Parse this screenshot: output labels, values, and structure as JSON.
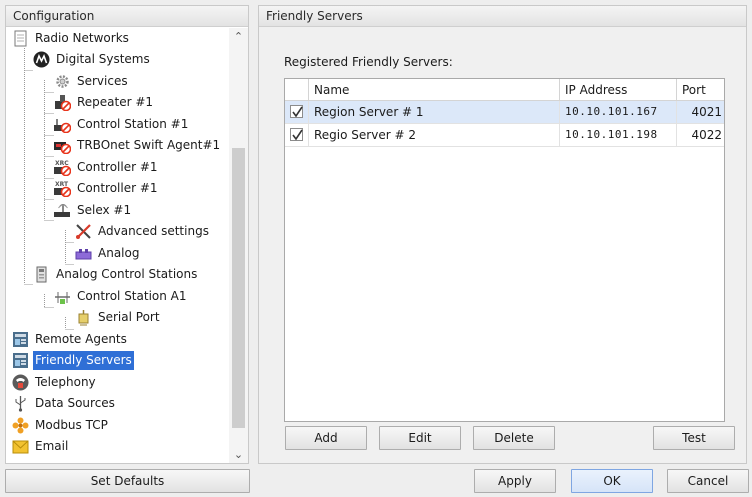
{
  "left": {
    "header": "Configuration",
    "tree": [
      {
        "label": "Radio Networks",
        "icon": "document-icon"
      },
      {
        "label": "Digital Systems",
        "icon": "motorola-logo-icon"
      },
      {
        "label": "Services",
        "icon": "gear-icon"
      },
      {
        "label": "Repeater #1",
        "icon": "repeater-disabled-icon"
      },
      {
        "label": "Control Station #1",
        "icon": "control-station-disabled-icon"
      },
      {
        "label": "TRBOnet Swift Agent#1",
        "icon": "swift-agent-disabled-icon"
      },
      {
        "label": "Controller #1",
        "icon": "xrc-controller-disabled-icon"
      },
      {
        "label": "Controller #1",
        "icon": "xrt-controller-disabled-icon"
      },
      {
        "label": "Selex #1",
        "icon": "selex-icon"
      },
      {
        "label": "Advanced settings",
        "icon": "wrench-screwdriver-icon"
      },
      {
        "label": "Analog",
        "icon": "analog-plug-icon"
      },
      {
        "label": "Analog Control Stations",
        "icon": "analog-station-icon"
      },
      {
        "label": "Control Station A1",
        "icon": "network-node-icon"
      },
      {
        "label": "Serial Port",
        "icon": "serial-port-icon"
      },
      {
        "label": "Remote Agents",
        "icon": "server-agent-icon"
      },
      {
        "label": "Friendly Servers",
        "icon": "friendly-server-icon"
      },
      {
        "label": "Telephony",
        "icon": "telephone-icon"
      },
      {
        "label": "Data Sources",
        "icon": "usb-icon"
      },
      {
        "label": "Modbus TCP",
        "icon": "modbus-icon"
      },
      {
        "label": "Email",
        "icon": "envelope-icon"
      }
    ],
    "selected": "Friendly Servers",
    "set_defaults": "Set Defaults"
  },
  "right": {
    "header": "Friendly Servers",
    "section_label": "Registered Friendly Servers:",
    "columns": [
      "Name",
      "IP Address",
      "Port"
    ],
    "rows": [
      {
        "checked": true,
        "name": "Region Server # 1",
        "ip": "10.10.101.167",
        "port": "4021"
      },
      {
        "checked": true,
        "name": "Regio Server # 2",
        "ip": "10.10.101.198",
        "port": "4022"
      }
    ],
    "buttons": {
      "add": "Add",
      "edit": "Edit",
      "delete": "Delete",
      "test": "Test"
    }
  },
  "footer": {
    "apply": "Apply",
    "ok": "OK",
    "cancel": "Cancel"
  },
  "colors": {
    "selection": "#2f6fd6",
    "row_highlight": "#dce8f9",
    "disabled_badge": "#e8341c"
  }
}
